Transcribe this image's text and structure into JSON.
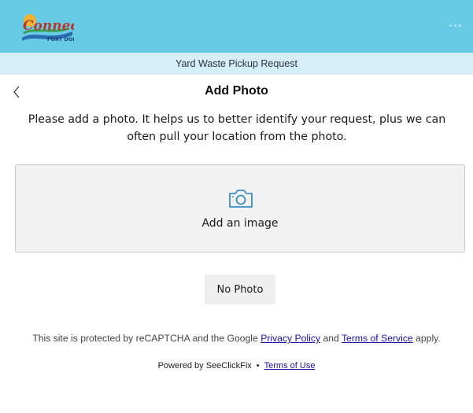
{
  "header": {
    "logo_text": "Connect",
    "logo_subtext": "FORT DODGE",
    "menu_icon": "more-dots-icon",
    "bg_color": "#67cbe6"
  },
  "subheader": {
    "title": "Yard Waste Pickup Request",
    "bg_color": "#d6eef8"
  },
  "page": {
    "back_icon": "chevron-left-icon",
    "title": "Add Photo",
    "instructions": "Please add a photo. It helps us to better identify your request, plus we can often pull your location from the photo."
  },
  "upload": {
    "icon": "camera-icon",
    "label": "Add an image"
  },
  "actions": {
    "no_photo_label": "No Photo"
  },
  "footer": {
    "recaptcha_prefix": "This site is protected by reCAPTCHA and the Google",
    "privacy_link": "Privacy Policy",
    "and_text": "and",
    "terms_link": "Terms of Service",
    "apply_text": "apply.",
    "powered_by": "Powered by SeeClickFix",
    "separator": "•",
    "terms_of_use": "Terms of Use",
    "link_color": "#1a0dab"
  }
}
